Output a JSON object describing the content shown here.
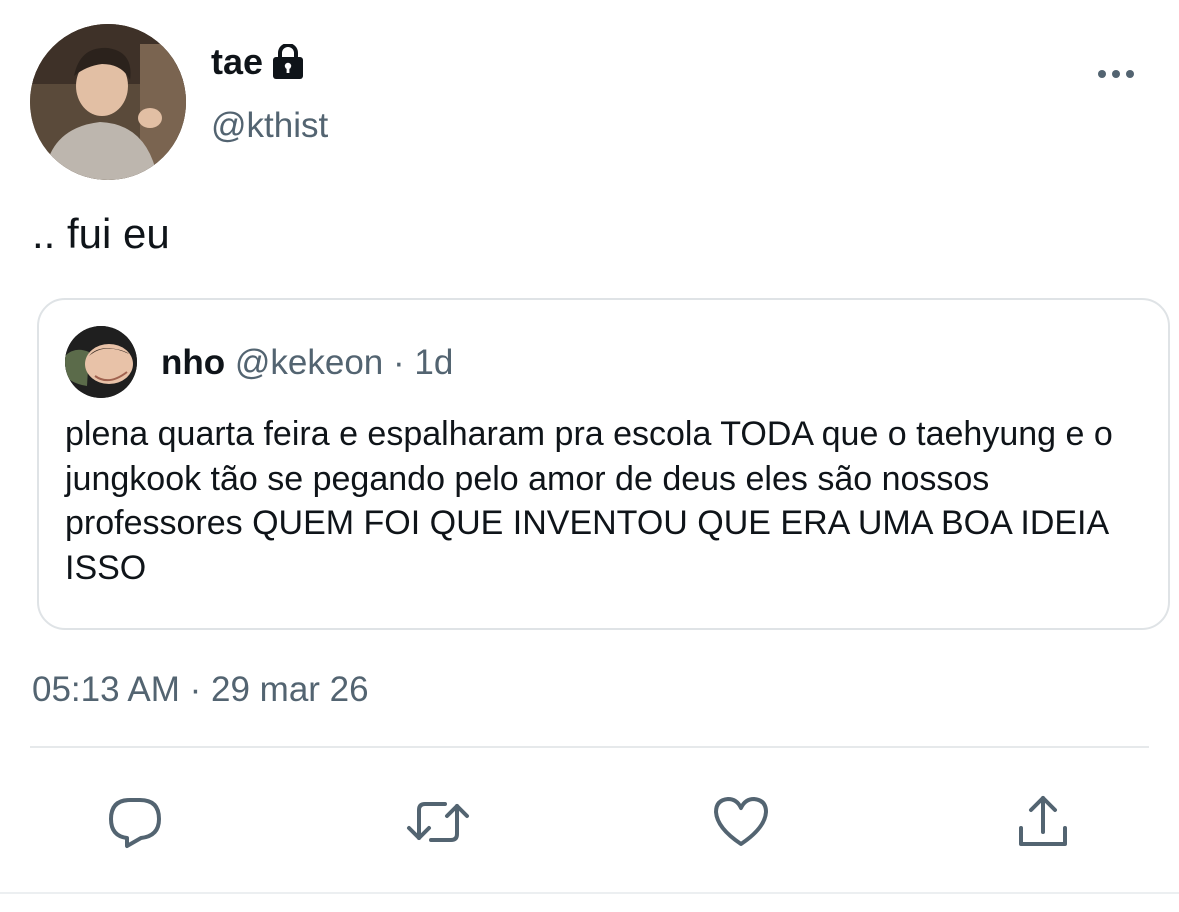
{
  "author": {
    "display_name": "tae",
    "handle": "@kthist",
    "avatar_icon": "profile-photo",
    "protected_icon": "lock-icon"
  },
  "tweet": {
    "text": ".. fui eu",
    "timestamp": "05:13 AM",
    "separator": "·",
    "date": "29 mar 26"
  },
  "quoted_tweet": {
    "display_name": "nho",
    "handle": "@kekeon",
    "separator": "·",
    "age": "1d",
    "text": "plena quarta feira e espalharam pra escola TODA que o taehyung e o jungkook tão se pegando pelo amor de deus eles são nossos professores QUEM FOI QUE INVENTOU QUE ERA UMA BOA IDEIA ISSO"
  },
  "actions": [
    {
      "name": "reply",
      "icon": "reply-icon"
    },
    {
      "name": "retweet",
      "icon": "retweet-icon"
    },
    {
      "name": "like",
      "icon": "heart-icon"
    },
    {
      "name": "share",
      "icon": "share-icon"
    }
  ],
  "colors": {
    "primary_text": "#0f1419",
    "secondary_text": "#536471",
    "icon_gray": "#536471",
    "border": "#dfe3e6"
  }
}
